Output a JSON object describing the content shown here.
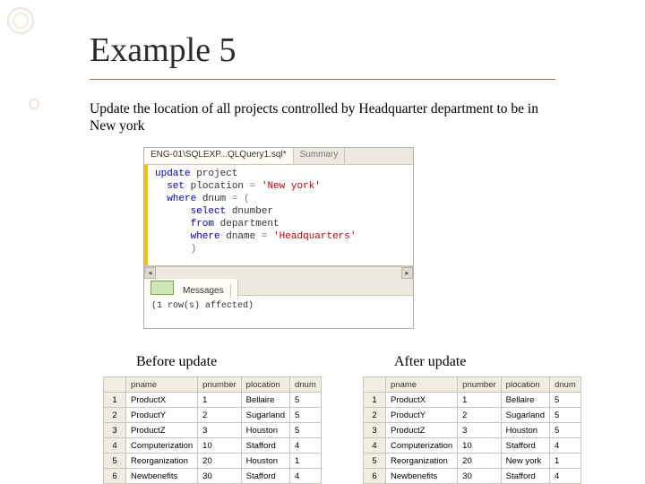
{
  "title": "Example 5",
  "description": "Update  the location of all projects controlled by Headquarter department to be in New york",
  "ssms": {
    "tab_active": "ENG-01\\SQLEXP...QLQuery1.sql*",
    "tab_inactive": "Summary",
    "sql": {
      "l1_kw1": "update",
      "l1_id": " project",
      "l2_kw1": "set",
      "l2_rest": " plocation ",
      "l2_op": "=",
      "l2_sp": " ",
      "l2_str": "'New york'",
      "l3_kw1": "where",
      "l3_rest": " dnum ",
      "l3_op": "=",
      "l3_paren": " (",
      "l4_kw1": "select",
      "l4_rest": " dnumber",
      "l5_kw1": "from",
      "l5_rest": " department",
      "l6_kw1": "where",
      "l6_rest": " dname ",
      "l6_op": "=",
      "l6_sp": " ",
      "l6_str": "'Headquarters'",
      "l7": ")"
    },
    "messages_tab": "Messages",
    "messages_text": "(1 row(s) affected)"
  },
  "labels": {
    "before": "Before update",
    "after": "After update"
  },
  "columns": {
    "c1": "pname",
    "c2": "pnumber",
    "c3": "plocation",
    "c4": "dnum"
  },
  "rowidx": {
    "r1": "1",
    "r2": "2",
    "r3": "3",
    "r4": "4",
    "r5": "5",
    "r6": "6"
  },
  "before": {
    "r1": {
      "pname": "ProductX",
      "pnumber": "1",
      "plocation": "Bellaire",
      "dnum": "5"
    },
    "r2": {
      "pname": "ProductY",
      "pnumber": "2",
      "plocation": "Sugarland",
      "dnum": "5"
    },
    "r3": {
      "pname": "ProductZ",
      "pnumber": "3",
      "plocation": "Houston",
      "dnum": "5"
    },
    "r4": {
      "pname": "Computerization",
      "pnumber": "10",
      "plocation": "Stafford",
      "dnum": "4"
    },
    "r5": {
      "pname": "Reorganization",
      "pnumber": "20",
      "plocation": "Houston",
      "dnum": "1"
    },
    "r6": {
      "pname": "Newbenefits",
      "pnumber": "30",
      "plocation": "Stafford",
      "dnum": "4"
    }
  },
  "after": {
    "r1": {
      "pname": "ProductX",
      "pnumber": "1",
      "plocation": "Bellaire",
      "dnum": "5"
    },
    "r2": {
      "pname": "ProductY",
      "pnumber": "2",
      "plocation": "Sugarland",
      "dnum": "5"
    },
    "r3": {
      "pname": "ProductZ",
      "pnumber": "3",
      "plocation": "Houston",
      "dnum": "5"
    },
    "r4": {
      "pname": "Computerization",
      "pnumber": "10",
      "plocation": "Stafford",
      "dnum": "4"
    },
    "r5": {
      "pname": "Reorganization",
      "pnumber": "20",
      "plocation": "New york",
      "dnum": "1"
    },
    "r6": {
      "pname": "Newbenefits",
      "pnumber": "30",
      "plocation": "Stafford",
      "dnum": "4"
    }
  }
}
